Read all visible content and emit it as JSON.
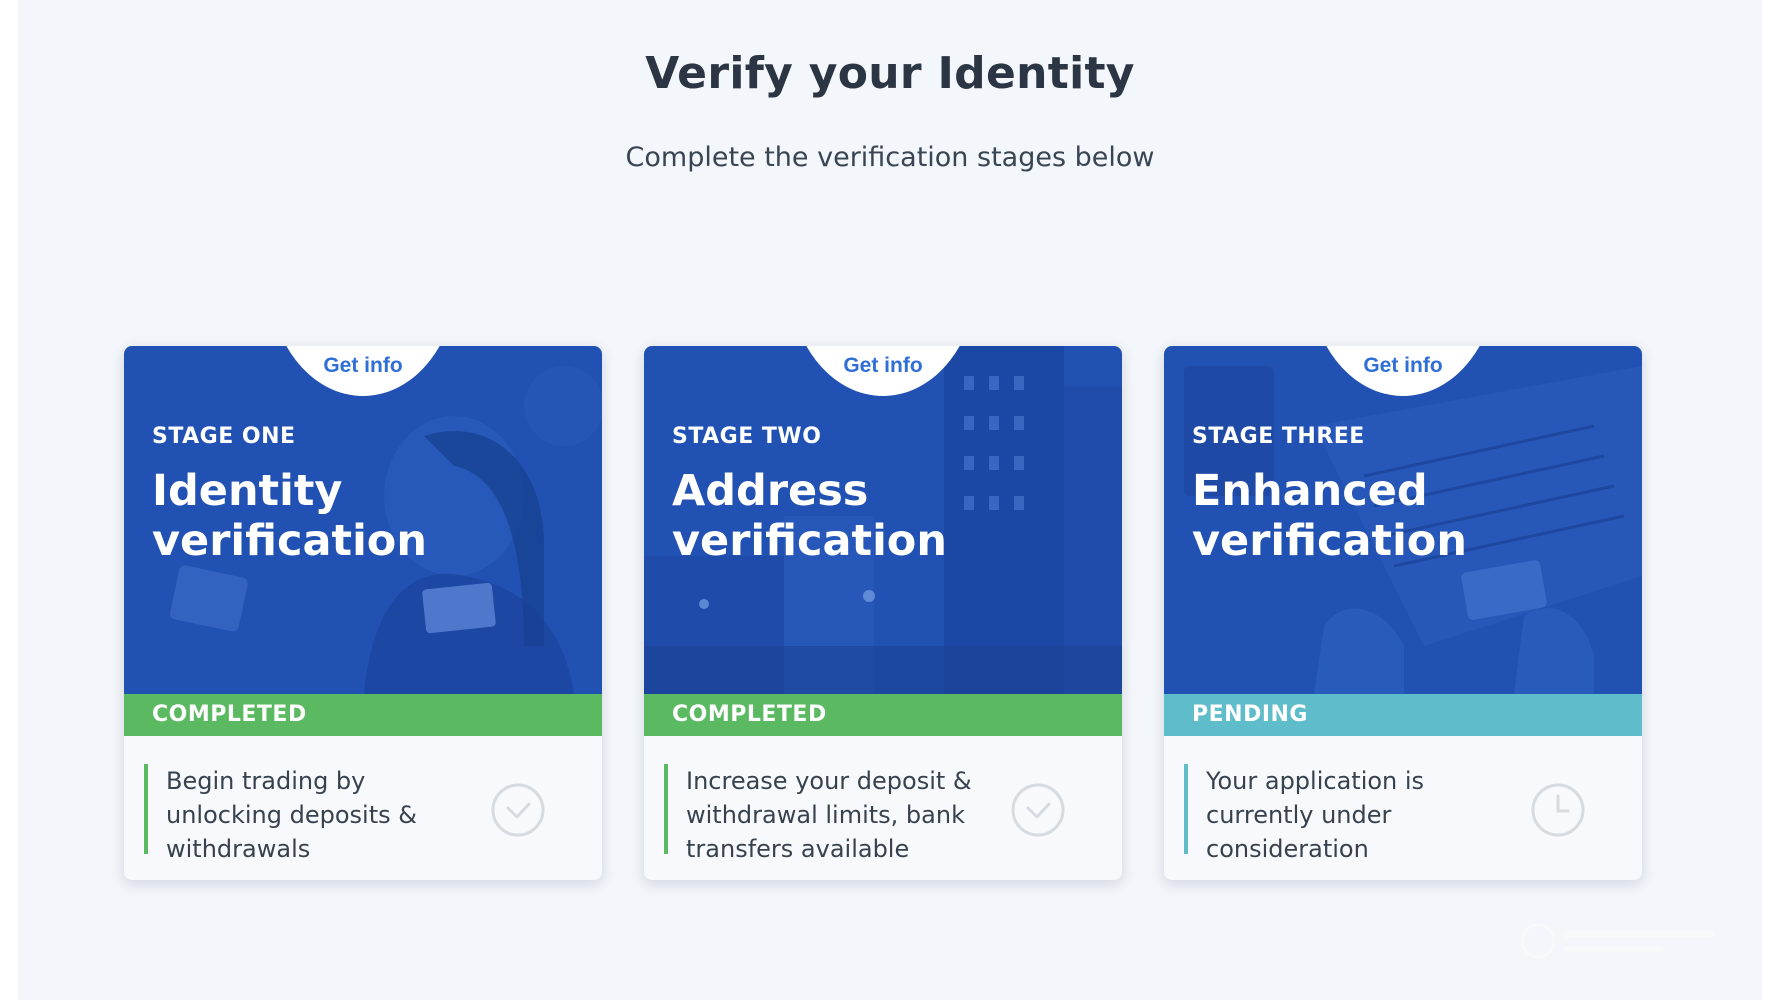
{
  "header": {
    "title": "Verify your Identity",
    "subtitle": "Complete the verification stages below"
  },
  "colors": {
    "hero_blue": "#2151b2",
    "completed_green": "#5bb962",
    "pending_teal": "#5fbcca",
    "link_blue": "#2f6fd6"
  },
  "cards": [
    {
      "get_info_label": "Get info",
      "stage_label": "STAGE ONE",
      "title": "Identity verification",
      "status": "COMPLETED",
      "description": "Begin trading by unlocking deposits & withdrawals",
      "icon": "check-circle-icon"
    },
    {
      "get_info_label": "Get info",
      "stage_label": "STAGE TWO",
      "title": "Address verification",
      "status": "COMPLETED",
      "description": "Increase your deposit & withdrawal limits, bank transfers available",
      "icon": "check-circle-icon"
    },
    {
      "get_info_label": "Get info",
      "stage_label": "STAGE THREE",
      "title": "Enhanced verification",
      "status": "PENDING",
      "description": "Your application is currently under consideration",
      "icon": "clock-icon"
    }
  ]
}
